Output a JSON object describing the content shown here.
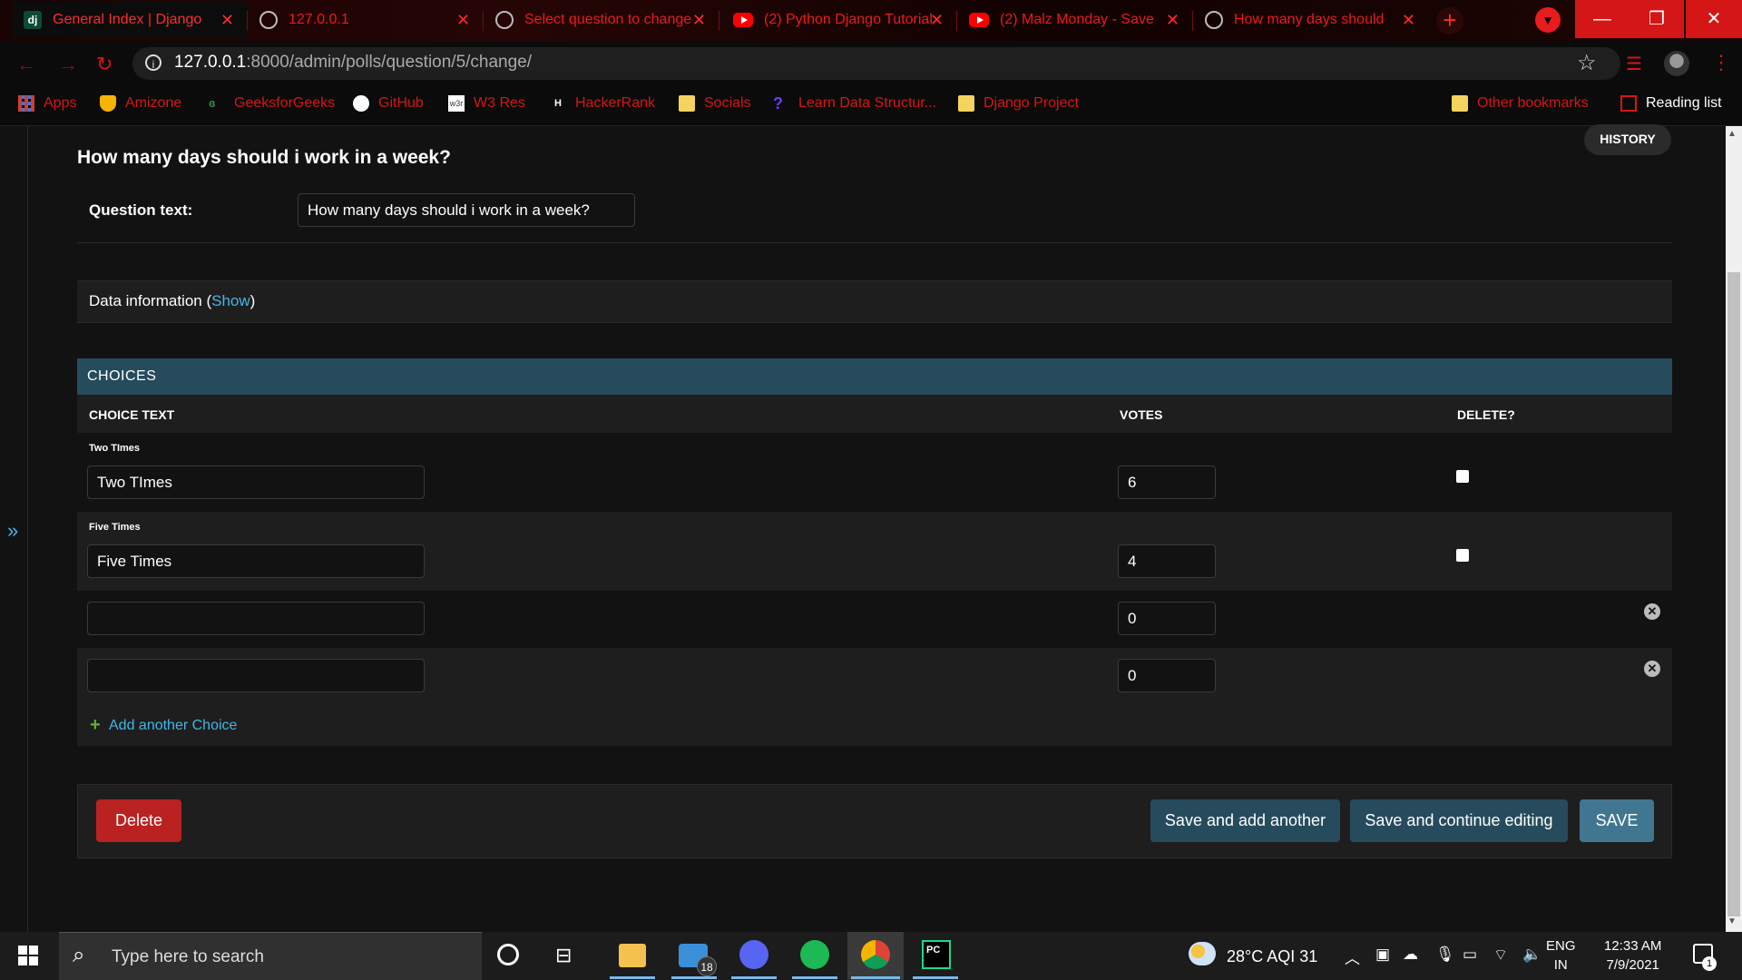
{
  "browser": {
    "tabs": [
      {
        "title": "General Index | Django",
        "favicon": "django-icon"
      },
      {
        "title": "127.0.0.1",
        "favicon": "globe-icon"
      },
      {
        "title": "Select question to change",
        "favicon": "globe-icon"
      },
      {
        "title": "(2) Python Django Tutorial",
        "favicon": "youtube-icon"
      },
      {
        "title": "(2) Malz Monday - Save",
        "favicon": "youtube-icon"
      },
      {
        "title": "How many days should",
        "favicon": "globe-icon"
      }
    ],
    "address": {
      "host": "127.0.0.1",
      "path": ":8000/admin/polls/question/5/change/"
    },
    "bookmarks": [
      {
        "label": "Apps"
      },
      {
        "label": "Amizone"
      },
      {
        "label": "GeeksforGeeks"
      },
      {
        "label": "GitHub"
      },
      {
        "label": "W3 Res"
      },
      {
        "label": "HackerRank"
      },
      {
        "label": "Socials"
      },
      {
        "label": "Learn Data Structur..."
      },
      {
        "label": "Django Project"
      },
      {
        "label": "Other bookmarks"
      },
      {
        "label": "Reading list"
      }
    ]
  },
  "page": {
    "history_label": "HISTORY",
    "title": "How many days should i work in a week?",
    "question_text_label": "Question text:",
    "question_text_value": "How many days should i work in a week?",
    "data_info": {
      "label": "Data information (",
      "link": "Show",
      "suffix": ")"
    },
    "choices": {
      "header": "CHOICES",
      "columns": {
        "text": "CHOICE TEXT",
        "votes": "VOTES",
        "delete": "DELETE?"
      },
      "rows": [
        {
          "label": "Two TImes",
          "text": "Two TImes",
          "votes": "6"
        },
        {
          "label": "Five Times",
          "text": "Five Times",
          "votes": "4"
        },
        {
          "label": "",
          "text": "",
          "votes": "0"
        },
        {
          "label": "",
          "text": "",
          "votes": "0"
        }
      ],
      "add_label": "Add another Choice"
    },
    "buttons": {
      "delete": "Delete",
      "save_add": "Save and add another",
      "save_continue": "Save and continue editing",
      "save": "SAVE"
    },
    "colors": {
      "accent": "#264b5d",
      "danger": "#ba2121",
      "link": "#44b5e6"
    }
  },
  "taskbar": {
    "search_placeholder": "Type here to search",
    "mail_badge": "18",
    "weather": "28°C  AQI 31",
    "lang_line1": "ENG",
    "lang_line2": "IN",
    "time": "12:33 AM",
    "date": "7/9/2021",
    "notification_count": "1"
  }
}
